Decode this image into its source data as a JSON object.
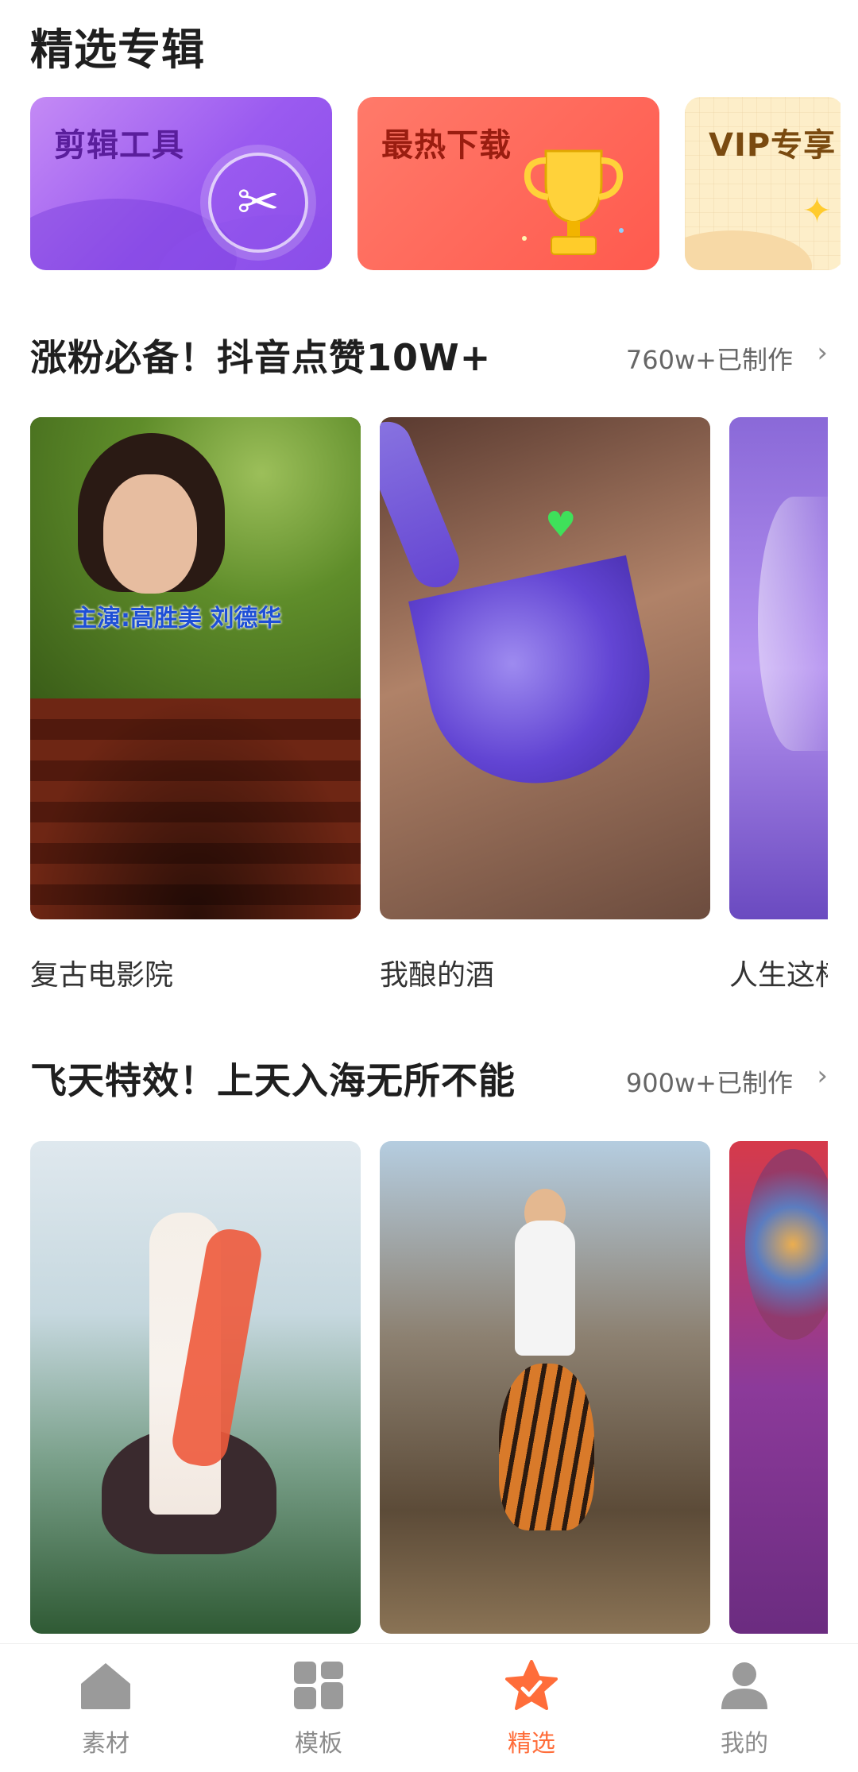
{
  "page": {
    "title": "精选专辑"
  },
  "featured_cards": [
    {
      "label": "剪辑工具",
      "icon": "scissors-icon"
    },
    {
      "label": "最热下载",
      "icon": "trophy-icon"
    },
    {
      "label": "VIP专享",
      "icon": "sparkle-icon"
    }
  ],
  "sections": [
    {
      "title": "涨粉必备！抖音点赞10W+",
      "count": "760w+已制作",
      "more_icon": "chevron-right-icon",
      "items": [
        {
          "caption": "复古电影院",
          "overlay_text": "主演:高胜美 刘德华"
        },
        {
          "caption": "我酿的酒"
        },
        {
          "caption": "人生这杯"
        }
      ]
    },
    {
      "title": "飞天特效！上天入海无所不能",
      "count": "900w+已制作",
      "more_icon": "chevron-right-icon",
      "items": [
        {
          "caption": ""
        },
        {
          "caption": ""
        },
        {
          "caption": ""
        }
      ]
    }
  ],
  "bottom_nav": [
    {
      "label": "素材",
      "icon": "home-icon",
      "active": false
    },
    {
      "label": "模板",
      "icon": "grid-icon",
      "active": false
    },
    {
      "label": "精选",
      "icon": "star-icon",
      "active": true
    },
    {
      "label": "我的",
      "icon": "user-icon",
      "active": false
    }
  ],
  "colors": {
    "accent": "#ff6d3a",
    "inactive": "#8c8c8c"
  }
}
